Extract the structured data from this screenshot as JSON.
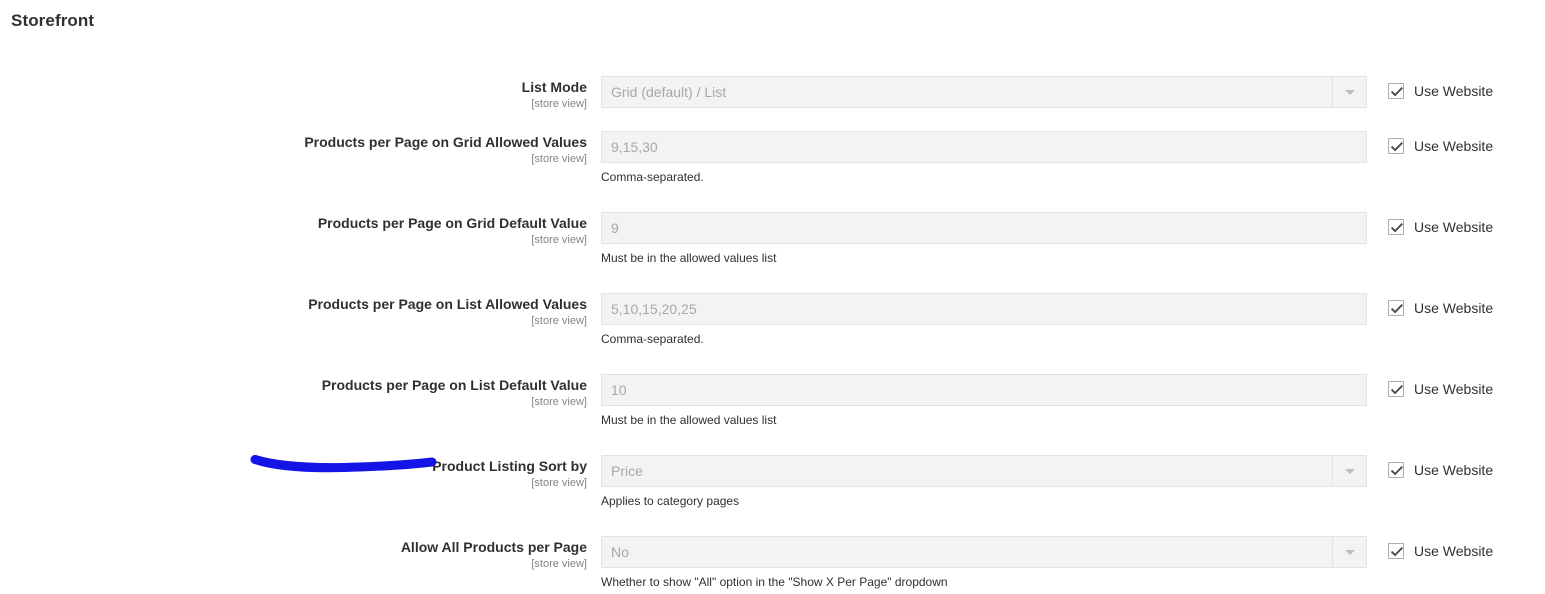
{
  "page": {
    "title": "Storefront"
  },
  "scope_label": "[store view]",
  "inherit_label": "Use Website",
  "icons": {
    "dropdown": "chevron-down-icon",
    "checkmark": "checkmark-icon",
    "annotation": "blue-underline-annotation"
  },
  "colors": {
    "annotation": "#1414e6",
    "input_background": "#f3f3f3",
    "input_border": "#e3e3e3",
    "placeholder_text": "#a8a8a8",
    "body_text": "#303030",
    "scope_text": "#858585"
  },
  "fields": [
    {
      "label": "List Mode",
      "scope": "[store view]",
      "type": "select",
      "value": "Grid (default) / List",
      "note": "",
      "inherit_checked": true,
      "inherit_label": "Use Website"
    },
    {
      "label": "Products per Page on Grid Allowed Values",
      "scope": "[store view]",
      "type": "text",
      "value": "9,15,30",
      "note": "Comma-separated.",
      "inherit_checked": true,
      "inherit_label": "Use Website"
    },
    {
      "label": "Products per Page on Grid Default Value",
      "scope": "[store view]",
      "type": "text",
      "value": "9",
      "note": "Must be in the allowed values list",
      "inherit_checked": true,
      "inherit_label": "Use Website"
    },
    {
      "label": "Products per Page on List Allowed Values",
      "scope": "[store view]",
      "type": "text",
      "value": "5,10,15,20,25",
      "note": "Comma-separated.",
      "inherit_checked": true,
      "inherit_label": "Use Website"
    },
    {
      "label": "Products per Page on List Default Value",
      "scope": "[store view]",
      "type": "text",
      "value": "10",
      "note": "Must be in the allowed values list",
      "inherit_checked": true,
      "inherit_label": "Use Website"
    },
    {
      "label": "Product Listing Sort by",
      "scope": "[store view]",
      "type": "select",
      "value": "Price",
      "note": "Applies to category pages",
      "inherit_checked": true,
      "inherit_label": "Use Website"
    },
    {
      "label": "Allow All Products per Page",
      "scope": "[store view]",
      "type": "select",
      "value": "No",
      "note": "Whether to show \"All\" option in the \"Show X Per Page\" dropdown",
      "inherit_checked": true,
      "inherit_label": "Use Website"
    }
  ]
}
